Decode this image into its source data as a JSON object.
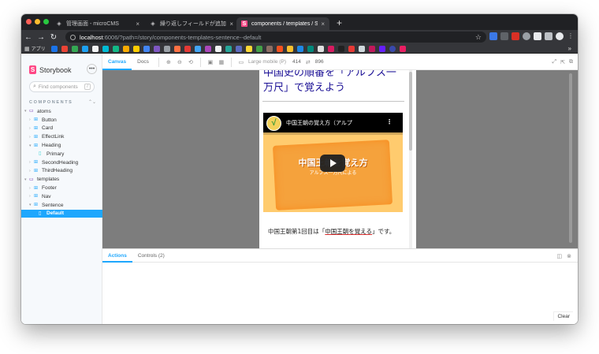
{
  "browser": {
    "tabs": [
      {
        "title": "管理画面 - microCMS",
        "icon": "diamond-icon",
        "active": false
      },
      {
        "title": "繰り返しフィールドが追加されま",
        "icon": "diamond-icon",
        "active": false
      },
      {
        "title": "components / templates / Sente",
        "icon": "storybook-icon",
        "active": true
      }
    ],
    "new_tab": "+",
    "url_host": "localhost",
    "url_path": ":6006/?path=/story/components-templates-sentence--default",
    "bookmarks_label": "アプリ",
    "bookmarks_more": "»"
  },
  "storybook": {
    "logo": "Storybook",
    "search_placeholder": "Find components",
    "search_shortcut": "/",
    "section_label": "COMPONENTS",
    "tree": [
      {
        "label": "atoms",
        "level": 0,
        "kind": "folder",
        "expanded": true
      },
      {
        "label": "Button",
        "level": 1,
        "kind": "component",
        "expanded": false
      },
      {
        "label": "Card",
        "level": 1,
        "kind": "component",
        "expanded": false
      },
      {
        "label": "EffectLink",
        "level": 1,
        "kind": "component",
        "expanded": false
      },
      {
        "label": "Heading",
        "level": 1,
        "kind": "component",
        "expanded": true
      },
      {
        "label": "Primary",
        "level": 2,
        "kind": "story"
      },
      {
        "label": "SecondHeading",
        "level": 1,
        "kind": "component",
        "expanded": false
      },
      {
        "label": "ThirdHeading",
        "level": 1,
        "kind": "component",
        "expanded": false
      },
      {
        "label": "templates",
        "level": 0,
        "kind": "folder",
        "expanded": true
      },
      {
        "label": "Footer",
        "level": 1,
        "kind": "component",
        "expanded": false
      },
      {
        "label": "Nav",
        "level": 1,
        "kind": "component",
        "expanded": false
      },
      {
        "label": "Sentence",
        "level": 1,
        "kind": "component",
        "expanded": true
      },
      {
        "label": "Default",
        "level": 2,
        "kind": "story",
        "active": true
      }
    ],
    "toolbar": {
      "canvas_tab": "Canvas",
      "docs_tab": "Docs",
      "viewport_label": "Large mobile (P)",
      "width": "414",
      "height": "896"
    },
    "addons": {
      "actions_tab": "Actions",
      "controls_tab": "Controls (2)",
      "clear_label": "Clear"
    }
  },
  "preview": {
    "heading": "中国史の順番を「アルフス一万尺」で覚えよう",
    "video_title": "中国王朝の覚え方（アルプ",
    "video_big_text": "中国王朝を覚え方",
    "video_small_text": "アルプス一万尺による",
    "video_avatar": "√",
    "para_before": "中国王朝第1回目は「",
    "para_link": "中国王朝を覚える",
    "para_after": "」です。"
  },
  "colors": {
    "storybook_accent": "#1ea7fd",
    "storybook_brand": "#ff4785",
    "heading_color": "#1a0f95"
  }
}
